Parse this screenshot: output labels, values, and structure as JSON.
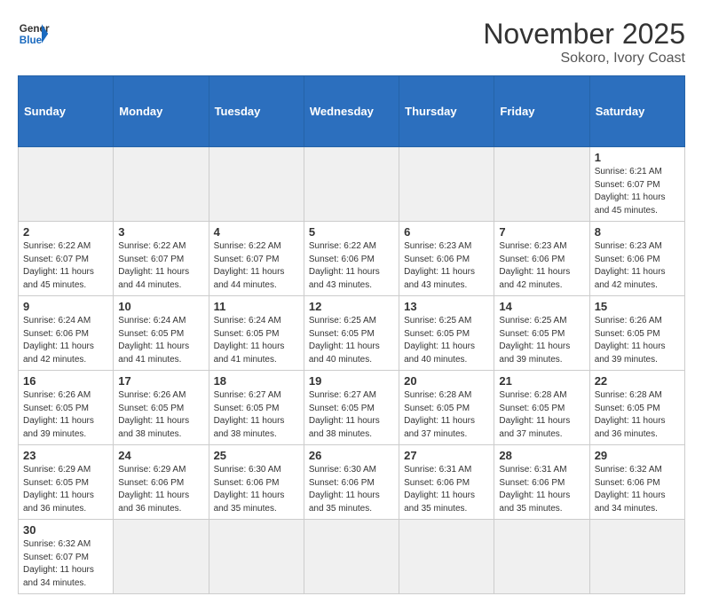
{
  "header": {
    "title": "November 2025",
    "subtitle": "Sokoro, Ivory Coast",
    "logo_general": "General",
    "logo_blue": "Blue"
  },
  "weekdays": [
    "Sunday",
    "Monday",
    "Tuesday",
    "Wednesday",
    "Thursday",
    "Friday",
    "Saturday"
  ],
  "weeks": [
    [
      {
        "day": "",
        "empty": true
      },
      {
        "day": "",
        "empty": true
      },
      {
        "day": "",
        "empty": true
      },
      {
        "day": "",
        "empty": true
      },
      {
        "day": "",
        "empty": true
      },
      {
        "day": "",
        "empty": true
      },
      {
        "day": "1",
        "sunrise": "Sunrise: 6:21 AM",
        "sunset": "Sunset: 6:07 PM",
        "daylight": "Daylight: 11 hours and 45 minutes."
      }
    ],
    [
      {
        "day": "2",
        "sunrise": "Sunrise: 6:22 AM",
        "sunset": "Sunset: 6:07 PM",
        "daylight": "Daylight: 11 hours and 45 minutes."
      },
      {
        "day": "3",
        "sunrise": "Sunrise: 6:22 AM",
        "sunset": "Sunset: 6:07 PM",
        "daylight": "Daylight: 11 hours and 44 minutes."
      },
      {
        "day": "4",
        "sunrise": "Sunrise: 6:22 AM",
        "sunset": "Sunset: 6:07 PM",
        "daylight": "Daylight: 11 hours and 44 minutes."
      },
      {
        "day": "5",
        "sunrise": "Sunrise: 6:22 AM",
        "sunset": "Sunset: 6:06 PM",
        "daylight": "Daylight: 11 hours and 43 minutes."
      },
      {
        "day": "6",
        "sunrise": "Sunrise: 6:23 AM",
        "sunset": "Sunset: 6:06 PM",
        "daylight": "Daylight: 11 hours and 43 minutes."
      },
      {
        "day": "7",
        "sunrise": "Sunrise: 6:23 AM",
        "sunset": "Sunset: 6:06 PM",
        "daylight": "Daylight: 11 hours and 42 minutes."
      },
      {
        "day": "8",
        "sunrise": "Sunrise: 6:23 AM",
        "sunset": "Sunset: 6:06 PM",
        "daylight": "Daylight: 11 hours and 42 minutes."
      }
    ],
    [
      {
        "day": "9",
        "sunrise": "Sunrise: 6:24 AM",
        "sunset": "Sunset: 6:06 PM",
        "daylight": "Daylight: 11 hours and 42 minutes."
      },
      {
        "day": "10",
        "sunrise": "Sunrise: 6:24 AM",
        "sunset": "Sunset: 6:05 PM",
        "daylight": "Daylight: 11 hours and 41 minutes."
      },
      {
        "day": "11",
        "sunrise": "Sunrise: 6:24 AM",
        "sunset": "Sunset: 6:05 PM",
        "daylight": "Daylight: 11 hours and 41 minutes."
      },
      {
        "day": "12",
        "sunrise": "Sunrise: 6:25 AM",
        "sunset": "Sunset: 6:05 PM",
        "daylight": "Daylight: 11 hours and 40 minutes."
      },
      {
        "day": "13",
        "sunrise": "Sunrise: 6:25 AM",
        "sunset": "Sunset: 6:05 PM",
        "daylight": "Daylight: 11 hours and 40 minutes."
      },
      {
        "day": "14",
        "sunrise": "Sunrise: 6:25 AM",
        "sunset": "Sunset: 6:05 PM",
        "daylight": "Daylight: 11 hours and 39 minutes."
      },
      {
        "day": "15",
        "sunrise": "Sunrise: 6:26 AM",
        "sunset": "Sunset: 6:05 PM",
        "daylight": "Daylight: 11 hours and 39 minutes."
      }
    ],
    [
      {
        "day": "16",
        "sunrise": "Sunrise: 6:26 AM",
        "sunset": "Sunset: 6:05 PM",
        "daylight": "Daylight: 11 hours and 39 minutes."
      },
      {
        "day": "17",
        "sunrise": "Sunrise: 6:26 AM",
        "sunset": "Sunset: 6:05 PM",
        "daylight": "Daylight: 11 hours and 38 minutes."
      },
      {
        "day": "18",
        "sunrise": "Sunrise: 6:27 AM",
        "sunset": "Sunset: 6:05 PM",
        "daylight": "Daylight: 11 hours and 38 minutes."
      },
      {
        "day": "19",
        "sunrise": "Sunrise: 6:27 AM",
        "sunset": "Sunset: 6:05 PM",
        "daylight": "Daylight: 11 hours and 38 minutes."
      },
      {
        "day": "20",
        "sunrise": "Sunrise: 6:28 AM",
        "sunset": "Sunset: 6:05 PM",
        "daylight": "Daylight: 11 hours and 37 minutes."
      },
      {
        "day": "21",
        "sunrise": "Sunrise: 6:28 AM",
        "sunset": "Sunset: 6:05 PM",
        "daylight": "Daylight: 11 hours and 37 minutes."
      },
      {
        "day": "22",
        "sunrise": "Sunrise: 6:28 AM",
        "sunset": "Sunset: 6:05 PM",
        "daylight": "Daylight: 11 hours and 36 minutes."
      }
    ],
    [
      {
        "day": "23",
        "sunrise": "Sunrise: 6:29 AM",
        "sunset": "Sunset: 6:05 PM",
        "daylight": "Daylight: 11 hours and 36 minutes."
      },
      {
        "day": "24",
        "sunrise": "Sunrise: 6:29 AM",
        "sunset": "Sunset: 6:06 PM",
        "daylight": "Daylight: 11 hours and 36 minutes."
      },
      {
        "day": "25",
        "sunrise": "Sunrise: 6:30 AM",
        "sunset": "Sunset: 6:06 PM",
        "daylight": "Daylight: 11 hours and 35 minutes."
      },
      {
        "day": "26",
        "sunrise": "Sunrise: 6:30 AM",
        "sunset": "Sunset: 6:06 PM",
        "daylight": "Daylight: 11 hours and 35 minutes."
      },
      {
        "day": "27",
        "sunrise": "Sunrise: 6:31 AM",
        "sunset": "Sunset: 6:06 PM",
        "daylight": "Daylight: 11 hours and 35 minutes."
      },
      {
        "day": "28",
        "sunrise": "Sunrise: 6:31 AM",
        "sunset": "Sunset: 6:06 PM",
        "daylight": "Daylight: 11 hours and 35 minutes."
      },
      {
        "day": "29",
        "sunrise": "Sunrise: 6:32 AM",
        "sunset": "Sunset: 6:06 PM",
        "daylight": "Daylight: 11 hours and 34 minutes."
      }
    ],
    [
      {
        "day": "30",
        "sunrise": "Sunrise: 6:32 AM",
        "sunset": "Sunset: 6:07 PM",
        "daylight": "Daylight: 11 hours and 34 minutes."
      },
      {
        "day": "",
        "empty": true
      },
      {
        "day": "",
        "empty": true
      },
      {
        "day": "",
        "empty": true
      },
      {
        "day": "",
        "empty": true
      },
      {
        "day": "",
        "empty": true
      },
      {
        "day": "",
        "empty": true
      }
    ]
  ]
}
